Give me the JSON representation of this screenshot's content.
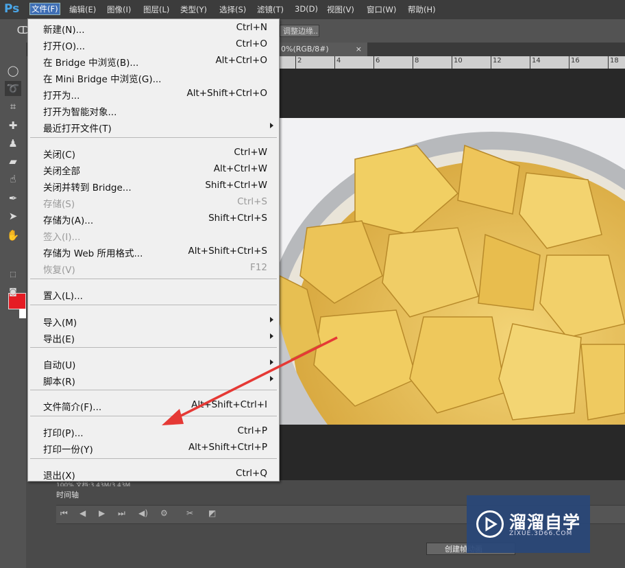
{
  "app": {
    "logo": "Ps"
  },
  "menubar": {
    "items": [
      {
        "label": "文件(F)"
      },
      {
        "label": "编辑(E)"
      },
      {
        "label": "图像(I)"
      },
      {
        "label": "图层(L)"
      },
      {
        "label": "类型(Y)"
      },
      {
        "label": "选择(S)"
      },
      {
        "label": "滤镜(T)"
      },
      {
        "label": "3D(D)"
      },
      {
        "label": "视图(V)"
      },
      {
        "label": "窗口(W)"
      },
      {
        "label": "帮助(H)"
      }
    ]
  },
  "options": {
    "refine_edge": "调整边缘..."
  },
  "document": {
    "tab_title": "0%(RGB/8#)",
    "tab_close": "×",
    "ruler_ticks": [
      "2",
      "4",
      "6",
      "8",
      "10",
      "12",
      "14",
      "16",
      "18"
    ]
  },
  "file_menu": {
    "items": [
      {
        "label": "新建(N)...",
        "shortcut": "Ctrl+N",
        "enabled": true
      },
      {
        "label": "打开(O)...",
        "shortcut": "Ctrl+O",
        "enabled": true
      },
      {
        "label": "在 Bridge 中浏览(B)...",
        "shortcut": "Alt+Ctrl+O",
        "enabled": true
      },
      {
        "label": "在 Mini Bridge 中浏览(G)...",
        "shortcut": "",
        "enabled": true
      },
      {
        "label": "打开为...",
        "shortcut": "Alt+Shift+Ctrl+O",
        "enabled": true
      },
      {
        "label": "打开为智能对象...",
        "shortcut": "",
        "enabled": true
      },
      {
        "label": "最近打开文件(T)",
        "shortcut": "",
        "enabled": true,
        "submenu": true
      },
      {
        "label": "关闭(C)",
        "shortcut": "Ctrl+W",
        "enabled": true
      },
      {
        "label": "关闭全部",
        "shortcut": "Alt+Ctrl+W",
        "enabled": true
      },
      {
        "label": "关闭并转到 Bridge...",
        "shortcut": "Shift+Ctrl+W",
        "enabled": true
      },
      {
        "label": "存储(S)",
        "shortcut": "Ctrl+S",
        "enabled": false
      },
      {
        "label": "存储为(A)...",
        "shortcut": "Shift+Ctrl+S",
        "enabled": true
      },
      {
        "label": "签入(I)...",
        "shortcut": "",
        "enabled": false
      },
      {
        "label": "存储为 Web 所用格式...",
        "shortcut": "Alt+Shift+Ctrl+S",
        "enabled": true
      },
      {
        "label": "恢复(V)",
        "shortcut": "F12",
        "enabled": false
      },
      {
        "label": "置入(L)...",
        "shortcut": "",
        "enabled": true
      },
      {
        "label": "导入(M)",
        "shortcut": "",
        "enabled": true,
        "submenu": true
      },
      {
        "label": "导出(E)",
        "shortcut": "",
        "enabled": true,
        "submenu": true
      },
      {
        "label": "自动(U)",
        "shortcut": "",
        "enabled": true,
        "submenu": true
      },
      {
        "label": "脚本(R)",
        "shortcut": "",
        "enabled": true,
        "submenu": true
      },
      {
        "label": "文件简介(F)...",
        "shortcut": "Alt+Shift+Ctrl+I",
        "enabled": true
      },
      {
        "label": "打印(P)...",
        "shortcut": "Ctrl+P",
        "enabled": true
      },
      {
        "label": "打印一份(Y)",
        "shortcut": "Alt+Shift+Ctrl+P",
        "enabled": true
      },
      {
        "label": "退出(X)",
        "shortcut": "Ctrl+Q",
        "enabled": true
      }
    ]
  },
  "statusbar": {
    "text": "100%     文档:3.43M/3.43M"
  },
  "timeline": {
    "title": "时间轴",
    "create_button": "创建帧动画"
  },
  "watermark": {
    "name": "溜溜自学",
    "url": "ZIXUE.3D66.COM"
  },
  "colors": {
    "foreground": "#e51c24",
    "background": "#ffffff",
    "annotation_arrow": "#e53935"
  }
}
